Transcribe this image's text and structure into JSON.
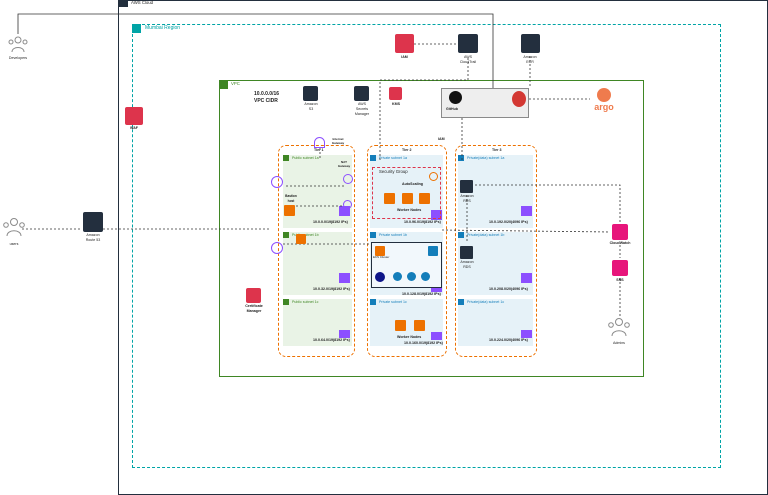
{
  "cloud": {
    "label": "AWS Cloud",
    "icon": "aws-cloud-icon"
  },
  "region": {
    "label": "Mumbai Region",
    "icon": "region-flag-icon"
  },
  "vpc": {
    "label": "VPC",
    "cidr_title": "10.0.0.0/16",
    "cidr_label": "VPC CIDR"
  },
  "actors": {
    "developers": "Developers",
    "users": "users",
    "admins": "Admins"
  },
  "services": {
    "waf": "WAF",
    "route53_line1": "Amazon",
    "route53_line2": "Route 53",
    "iam_top": "IAM",
    "cloudtrail_line1": "AWS",
    "cloudtrail_line2": "CloudTrail",
    "ecr_line1": "Amazon",
    "ecr_line2": "ECR",
    "s3_line1": "Amazon",
    "s3_line2": "S3",
    "secrets_line1": "AWS",
    "secrets_line2": "Secrets",
    "secrets_line3": "Manager",
    "kms": "KMS",
    "github": "GitHub",
    "argo": "argo",
    "cert_line1": "Certificate",
    "cert_line2": "Manager",
    "cloudwatch": "CloudWatch",
    "sns": "SNS",
    "igw_line1": "Internet",
    "igw_line2": "Gateway",
    "nat_line1": "NAT",
    "nat_line2": "Gateway",
    "bastion_line1": "Bastion",
    "bastion_line2": "host",
    "rds_a_line1": "Amazon",
    "rds_a_line2": "RDS",
    "rds_b_line1": "Amazon",
    "rds_b_line2": "RDS",
    "eks_label": "EKS Cluster",
    "iam_mid": "IAM"
  },
  "tiers": {
    "tier1": "Tier 1",
    "tier2": "Tier 2",
    "tier3": "Tier 3"
  },
  "subnets": {
    "pub_1a": {
      "label": "Public subnet 1a",
      "cidr": "10.0.0.0/19(8192 IPs)"
    },
    "pub_1b": {
      "label": "Public subnet 1b",
      "cidr": "10.0.32.0/19(8192 IPs)"
    },
    "pub_1c": {
      "label": "Public subnet 1c",
      "cidr": "10.0.64.0/19(8192 IPs)"
    },
    "priv_1a": {
      "label": "Private subnet 1a",
      "cidr": "10.0.96.0/19(8192 IPs)"
    },
    "priv_1b": {
      "label": "Private subnet 1b",
      "cidr": "10.0.128.0/19(8192 IPs)"
    },
    "priv_1c": {
      "label": "Private subnet 1c",
      "cidr": "10.0.160.0/19(8192 IPs)"
    },
    "db_1a": {
      "label": "Private(data) subnet 1a",
      "cidr": "10.0.192.0/20(4096 IPs)"
    },
    "db_1b": {
      "label": "Private(data) subnet 1b",
      "cidr": "10.0.208.0/20(4096 IPs)"
    },
    "db_1c": {
      "label": "Private(data) subnet 1c",
      "cidr": "10.0.224.0/20(4096 IPs)"
    }
  },
  "groups": {
    "security_group": "Security Group",
    "autoscaling": "AutoScaling",
    "worker_nodes_a": "Worker Nodes",
    "worker_nodes_c": "Worker Nodes"
  },
  "colors": {
    "aws_dark": "#232f3e",
    "region_teal": "#00a4a6",
    "vpc_green": "#3f8624",
    "tier_orange": "#ed7100",
    "public_fill": "#e9f3e6",
    "private_fill": "#e6f2f8",
    "sg_red": "#dd344c",
    "ec2_orange": "#ed7100",
    "waf_red": "#dd344c",
    "pink": "#e7157b",
    "purple": "#8c4fff",
    "blue": "#147eba"
  }
}
